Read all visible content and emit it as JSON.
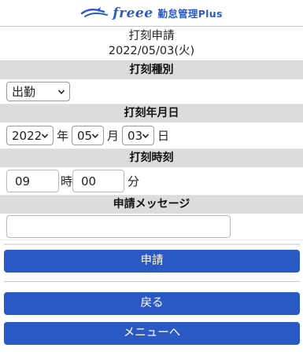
{
  "header": {
    "logo_text": "freee",
    "logo_sub": "勤怠管理Plus"
  },
  "title": {
    "line1": "打刻申請",
    "line2": "2022/05/03(火)"
  },
  "sections": {
    "type_label": "打刻種別",
    "date_label": "打刻年月日",
    "time_label": "打刻時刻",
    "message_label": "申請メッセージ"
  },
  "form": {
    "type_value": "出勤",
    "year_value": "2022",
    "year_unit": "年",
    "month_value": "05",
    "month_unit": "月",
    "day_value": "03",
    "day_unit": "日",
    "hour_value": "09",
    "hour_unit": "時",
    "minute_value": "00",
    "minute_unit": "分",
    "message_value": ""
  },
  "buttons": {
    "submit": "申請",
    "back": "戻る",
    "menu": "メニューへ"
  },
  "colors": {
    "brand": "#2a5bc6",
    "button": "#2b59c3",
    "section_bg": "#dcdcdc"
  }
}
